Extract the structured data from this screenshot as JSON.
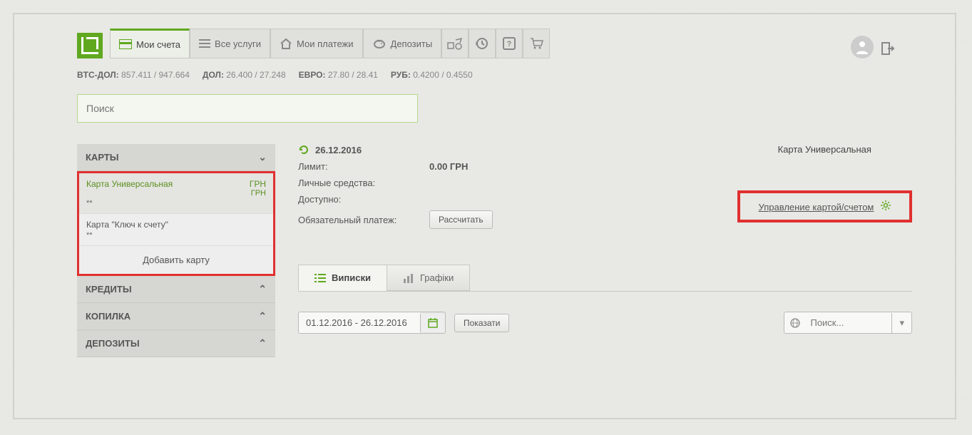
{
  "nav": {
    "tabs": [
      {
        "label": "Мои счета"
      },
      {
        "label": "Все услуги"
      },
      {
        "label": "Мои платежи"
      },
      {
        "label": "Депозиты"
      }
    ]
  },
  "rates": [
    {
      "label": "BTC-ДОЛ:",
      "value": "857.411 / 947.664"
    },
    {
      "label": "ДОЛ:",
      "value": "26.400 / 27.248"
    },
    {
      "label": "ЕВРО:",
      "value": "27.80 / 28.41"
    },
    {
      "label": "РУБ:",
      "value": "0.4200 / 0.4550"
    }
  ],
  "search_placeholder": "Поиск",
  "sidebar": {
    "sections": [
      {
        "label": "КАРТЫ"
      },
      {
        "label": "КРЕДИТЫ"
      },
      {
        "label": "КОПИЛКА"
      },
      {
        "label": "ДЕПОЗИТЫ"
      }
    ],
    "cards": [
      {
        "name": "Карта Универсальная",
        "curr1": "ГРН",
        "curr2": "ГРН",
        "mask": "**"
      },
      {
        "name": "Карта \"Ключ к счету\"",
        "mask": "**"
      }
    ],
    "add_card": "Добавить карту"
  },
  "main": {
    "date": "26.12.2016",
    "limit_label": "Лимит:",
    "limit_value": "0.00 ГРН",
    "own_label": "Личные средства:",
    "avail_label": "Доступно:",
    "payment_label": "Обязательный платеж:",
    "calc_btn": "Рассчитать",
    "card_title": "Карта Универсальная",
    "manage_link": "Управление картой/счетом",
    "subtabs": [
      {
        "label": "Виписки"
      },
      {
        "label": "Графіки"
      }
    ],
    "date_range": "01.12.2016 - 26.12.2016",
    "show_btn": "Показати",
    "search2_placeholder": "Поиск..."
  }
}
